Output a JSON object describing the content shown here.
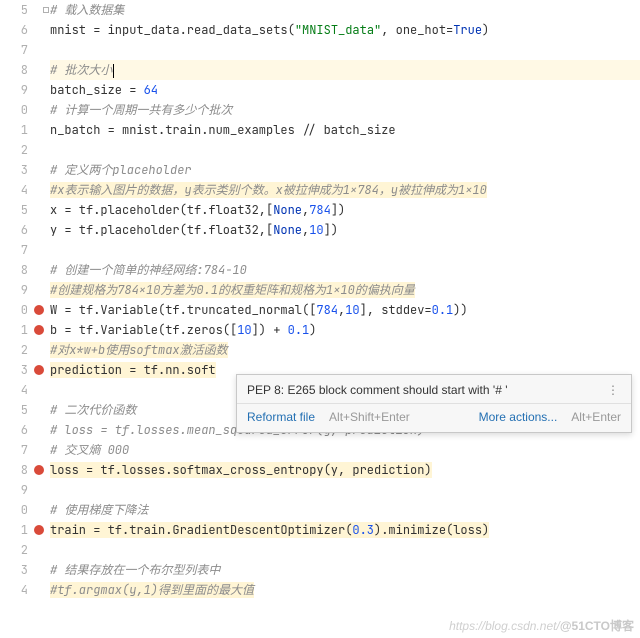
{
  "lines": [
    {
      "ln": "5",
      "bp": false,
      "kind": "cm",
      "text": "# 载入数据集"
    },
    {
      "ln": "6",
      "bp": false,
      "kind": "code",
      "text_html": "mnist = input_data.read_data_sets(<span class='str'>\"MNIST_data\"</span>, one_hot=<span class='kw2'>True</span>)"
    },
    {
      "ln": "7",
      "bp": false,
      "kind": "blank",
      "text": ""
    },
    {
      "ln": "8",
      "bp": false,
      "kind": "cm",
      "hl": true,
      "caret": true,
      "text": "# 批次大小"
    },
    {
      "ln": "9",
      "bp": false,
      "kind": "code",
      "text_html": "batch_size = <span class='num'>64</span>"
    },
    {
      "ln": "0",
      "bp": false,
      "kind": "cm",
      "text": "# 计算一个周期一共有多少个批次"
    },
    {
      "ln": "1",
      "bp": false,
      "kind": "code",
      "text_html": "n_batch = mnist.train.num_examples // batch_size"
    },
    {
      "ln": "2",
      "bp": false,
      "kind": "blank",
      "text": ""
    },
    {
      "ln": "3",
      "bp": false,
      "kind": "cm",
      "region": true,
      "text": "# 定义两个placeholder"
    },
    {
      "ln": "4",
      "bp": false,
      "kind": "cm",
      "warn": true,
      "text": "#x表示输入图片的数据，y表示类别个数。x被拉伸成为1×784，y被拉伸成为1×10"
    },
    {
      "ln": "5",
      "bp": false,
      "kind": "code",
      "text_html": "x = tf.placeholder(tf.float32,[<span class='kw2'>None</span>,<span class='num'>784</span>])"
    },
    {
      "ln": "6",
      "bp": false,
      "kind": "code",
      "text_html": "y = tf.placeholder(tf.float32,[<span class='kw2'>None</span>,<span class='num'>10</span>])"
    },
    {
      "ln": "7",
      "bp": false,
      "kind": "blank",
      "text": ""
    },
    {
      "ln": "8",
      "bp": false,
      "kind": "cm",
      "region": true,
      "text": "# 创建一个简单的神经网络:784-10"
    },
    {
      "ln": "9",
      "bp": false,
      "kind": "cm",
      "warn": true,
      "text": "#创建规格为784×10方差为0.1的权重矩阵和规格为1×10的偏执向量"
    },
    {
      "ln": "0",
      "bp": true,
      "kind": "code",
      "text_html": "W = tf.Variable(tf.truncated_normal([<span class='num'>784</span>,<span class='num'>10</span>], stddev=<span class='num'>0.1</span>))"
    },
    {
      "ln": "1",
      "bp": true,
      "kind": "code",
      "text_html": "b = tf.Variable(tf.zeros([<span class='num'>10</span>]) + <span class='num'>0.1</span>)"
    },
    {
      "ln": "2",
      "bp": false,
      "kind": "cm",
      "warn": true,
      "text": "#对x*w+b使用softmax激活函数"
    },
    {
      "ln": "3",
      "bp": true,
      "kind": "code",
      "warn": true,
      "text_html": "prediction = tf.nn.soft"
    },
    {
      "ln": "4",
      "bp": false,
      "kind": "blank",
      "text": ""
    },
    {
      "ln": "5",
      "bp": false,
      "kind": "cm",
      "region": true,
      "text": "# 二次代价函数"
    },
    {
      "ln": "6",
      "bp": false,
      "kind": "cm",
      "text": "# loss = tf.losses.mean_squared_error(y, prediction)"
    },
    {
      "ln": "7",
      "bp": false,
      "kind": "cm",
      "region": true,
      "text": "# 交叉熵 000"
    },
    {
      "ln": "8",
      "bp": true,
      "kind": "code",
      "warn": true,
      "text_html": "loss = tf.losses.softmax_cross_entropy(y, prediction)"
    },
    {
      "ln": "9",
      "bp": false,
      "kind": "blank",
      "text": ""
    },
    {
      "ln": "0",
      "bp": false,
      "kind": "cm",
      "text": "# 使用梯度下降法"
    },
    {
      "ln": "1",
      "bp": true,
      "kind": "code",
      "warn": true,
      "text_html": "train = tf.train.GradientDescentOptimizer(<span class='num'>0.3</span>).minimize(loss)"
    },
    {
      "ln": "2",
      "bp": false,
      "kind": "blank",
      "text": ""
    },
    {
      "ln": "3",
      "bp": false,
      "kind": "cm",
      "region": true,
      "text": "# 结果存放在一个布尔型列表中"
    },
    {
      "ln": "4",
      "bp": false,
      "kind": "cm",
      "warn": true,
      "text": "#tf.argmax(y,1)得到里面的最大值"
    }
  ],
  "tooltip": {
    "message": "PEP 8: E265 block comment should start with '# '",
    "more_icon": "⋮",
    "reformat_label": "Reformat file",
    "reformat_hint": "Alt+Shift+Enter",
    "more_actions_label": "More actions...",
    "more_actions_hint": "Alt+Enter"
  },
  "watermark": {
    "url": "https://blog.csdn.net/",
    "brand": "@51CTO博客"
  }
}
